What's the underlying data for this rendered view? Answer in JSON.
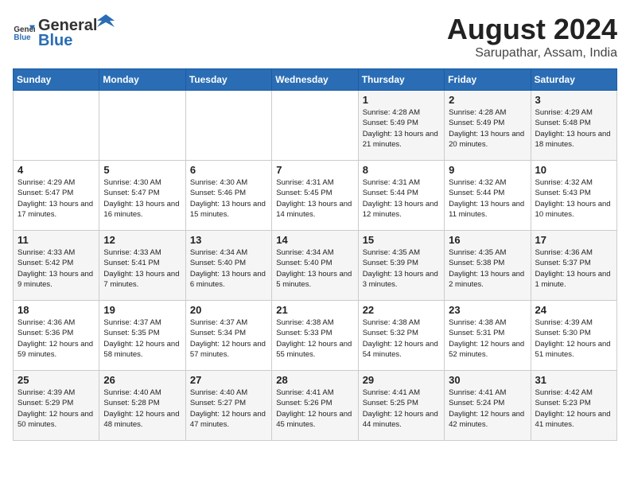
{
  "header": {
    "logo_general": "General",
    "logo_blue": "Blue",
    "month_title": "August 2024",
    "location": "Sarupathar, Assam, India"
  },
  "weekdays": [
    "Sunday",
    "Monday",
    "Tuesday",
    "Wednesday",
    "Thursday",
    "Friday",
    "Saturday"
  ],
  "weeks": [
    [
      {
        "day": "",
        "info": ""
      },
      {
        "day": "",
        "info": ""
      },
      {
        "day": "",
        "info": ""
      },
      {
        "day": "",
        "info": ""
      },
      {
        "day": "1",
        "info": "Sunrise: 4:28 AM\nSunset: 5:49 PM\nDaylight: 13 hours\nand 21 minutes."
      },
      {
        "day": "2",
        "info": "Sunrise: 4:28 AM\nSunset: 5:49 PM\nDaylight: 13 hours\nand 20 minutes."
      },
      {
        "day": "3",
        "info": "Sunrise: 4:29 AM\nSunset: 5:48 PM\nDaylight: 13 hours\nand 18 minutes."
      }
    ],
    [
      {
        "day": "4",
        "info": "Sunrise: 4:29 AM\nSunset: 5:47 PM\nDaylight: 13 hours\nand 17 minutes."
      },
      {
        "day": "5",
        "info": "Sunrise: 4:30 AM\nSunset: 5:47 PM\nDaylight: 13 hours\nand 16 minutes."
      },
      {
        "day": "6",
        "info": "Sunrise: 4:30 AM\nSunset: 5:46 PM\nDaylight: 13 hours\nand 15 minutes."
      },
      {
        "day": "7",
        "info": "Sunrise: 4:31 AM\nSunset: 5:45 PM\nDaylight: 13 hours\nand 14 minutes."
      },
      {
        "day": "8",
        "info": "Sunrise: 4:31 AM\nSunset: 5:44 PM\nDaylight: 13 hours\nand 12 minutes."
      },
      {
        "day": "9",
        "info": "Sunrise: 4:32 AM\nSunset: 5:44 PM\nDaylight: 13 hours\nand 11 minutes."
      },
      {
        "day": "10",
        "info": "Sunrise: 4:32 AM\nSunset: 5:43 PM\nDaylight: 13 hours\nand 10 minutes."
      }
    ],
    [
      {
        "day": "11",
        "info": "Sunrise: 4:33 AM\nSunset: 5:42 PM\nDaylight: 13 hours\nand 9 minutes."
      },
      {
        "day": "12",
        "info": "Sunrise: 4:33 AM\nSunset: 5:41 PM\nDaylight: 13 hours\nand 7 minutes."
      },
      {
        "day": "13",
        "info": "Sunrise: 4:34 AM\nSunset: 5:40 PM\nDaylight: 13 hours\nand 6 minutes."
      },
      {
        "day": "14",
        "info": "Sunrise: 4:34 AM\nSunset: 5:40 PM\nDaylight: 13 hours\nand 5 minutes."
      },
      {
        "day": "15",
        "info": "Sunrise: 4:35 AM\nSunset: 5:39 PM\nDaylight: 13 hours\nand 3 minutes."
      },
      {
        "day": "16",
        "info": "Sunrise: 4:35 AM\nSunset: 5:38 PM\nDaylight: 13 hours\nand 2 minutes."
      },
      {
        "day": "17",
        "info": "Sunrise: 4:36 AM\nSunset: 5:37 PM\nDaylight: 13 hours\nand 1 minute."
      }
    ],
    [
      {
        "day": "18",
        "info": "Sunrise: 4:36 AM\nSunset: 5:36 PM\nDaylight: 12 hours\nand 59 minutes."
      },
      {
        "day": "19",
        "info": "Sunrise: 4:37 AM\nSunset: 5:35 PM\nDaylight: 12 hours\nand 58 minutes."
      },
      {
        "day": "20",
        "info": "Sunrise: 4:37 AM\nSunset: 5:34 PM\nDaylight: 12 hours\nand 57 minutes."
      },
      {
        "day": "21",
        "info": "Sunrise: 4:38 AM\nSunset: 5:33 PM\nDaylight: 12 hours\nand 55 minutes."
      },
      {
        "day": "22",
        "info": "Sunrise: 4:38 AM\nSunset: 5:32 PM\nDaylight: 12 hours\nand 54 minutes."
      },
      {
        "day": "23",
        "info": "Sunrise: 4:38 AM\nSunset: 5:31 PM\nDaylight: 12 hours\nand 52 minutes."
      },
      {
        "day": "24",
        "info": "Sunrise: 4:39 AM\nSunset: 5:30 PM\nDaylight: 12 hours\nand 51 minutes."
      }
    ],
    [
      {
        "day": "25",
        "info": "Sunrise: 4:39 AM\nSunset: 5:29 PM\nDaylight: 12 hours\nand 50 minutes."
      },
      {
        "day": "26",
        "info": "Sunrise: 4:40 AM\nSunset: 5:28 PM\nDaylight: 12 hours\nand 48 minutes."
      },
      {
        "day": "27",
        "info": "Sunrise: 4:40 AM\nSunset: 5:27 PM\nDaylight: 12 hours\nand 47 minutes."
      },
      {
        "day": "28",
        "info": "Sunrise: 4:41 AM\nSunset: 5:26 PM\nDaylight: 12 hours\nand 45 minutes."
      },
      {
        "day": "29",
        "info": "Sunrise: 4:41 AM\nSunset: 5:25 PM\nDaylight: 12 hours\nand 44 minutes."
      },
      {
        "day": "30",
        "info": "Sunrise: 4:41 AM\nSunset: 5:24 PM\nDaylight: 12 hours\nand 42 minutes."
      },
      {
        "day": "31",
        "info": "Sunrise: 4:42 AM\nSunset: 5:23 PM\nDaylight: 12 hours\nand 41 minutes."
      }
    ]
  ]
}
